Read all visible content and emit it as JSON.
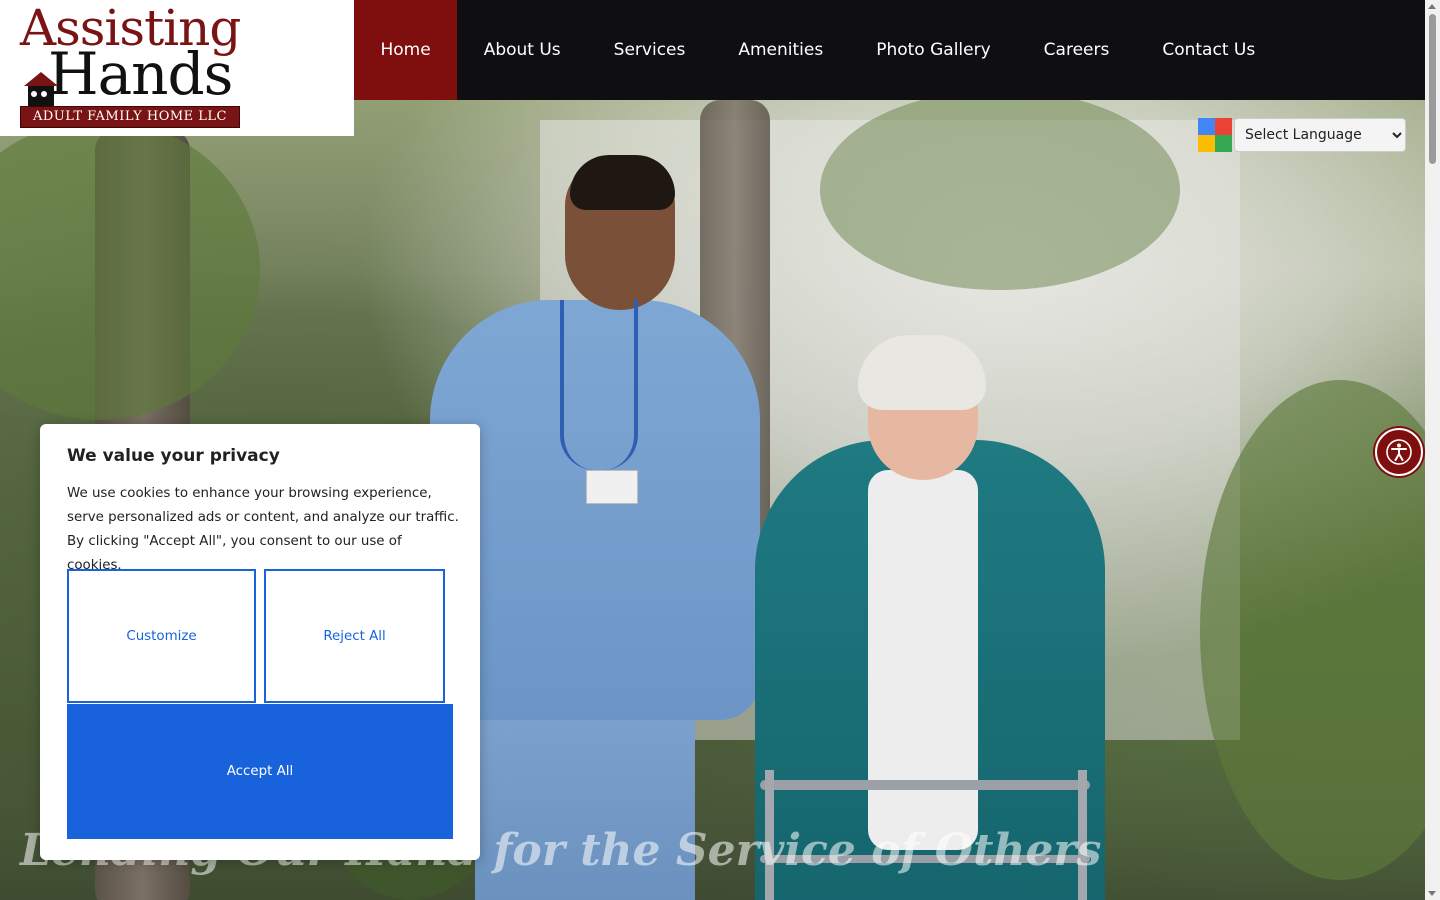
{
  "logo": {
    "title_line1": "Assisting",
    "title_line2": "Hands",
    "subtitle": "ADULT FAMILY HOME LLC"
  },
  "nav": {
    "items": [
      {
        "label": "Home",
        "active": true
      },
      {
        "label": "About Us",
        "active": false
      },
      {
        "label": "Services",
        "active": false
      },
      {
        "label": "Amenities",
        "active": false
      },
      {
        "label": "Photo Gallery",
        "active": false
      },
      {
        "label": "Careers",
        "active": false
      },
      {
        "label": "Contact Us",
        "active": false
      }
    ]
  },
  "language": {
    "selected": "Select Language",
    "icon": "google-translate-icon"
  },
  "hero": {
    "tagline": "Lending Our Hand for the Service of Others"
  },
  "accessibility": {
    "icon": "accessibility-icon"
  },
  "cookie": {
    "title": "We value your privacy",
    "body": "We use cookies to enhance your browsing experience, serve personalized ads or content, and analyze our traffic. By clicking \"Accept All\", you consent to our use of cookies.",
    "customize_label": "Customize",
    "reject_label": "Reject All",
    "accept_label": "Accept All"
  },
  "colors": {
    "brand_red": "#7f0e0e",
    "nav_bg": "#0f0f12",
    "cookie_blue": "#1863dc"
  }
}
